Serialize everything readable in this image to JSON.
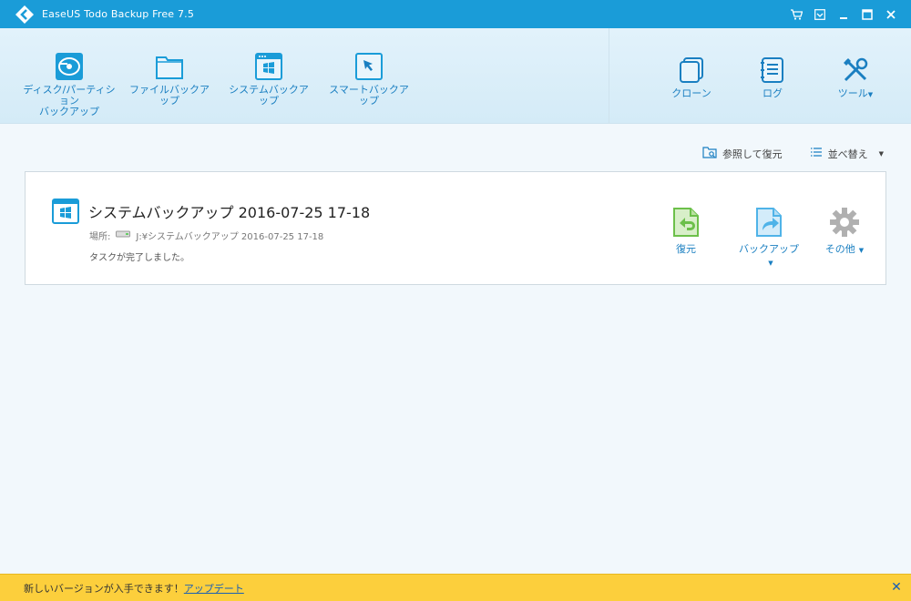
{
  "window": {
    "title": "EaseUS Todo Backup Free 7.5",
    "controls": [
      "cart-icon",
      "menu-icon",
      "minimize-icon",
      "maximize-icon",
      "close-icon"
    ]
  },
  "toolbar": {
    "left": [
      {
        "label_line1": "ディスク/パーティション",
        "label_line2": "バックアップ",
        "icon": "disk-backup-icon"
      },
      {
        "label_line1": "ファイルバックアップ",
        "label_line2": "",
        "icon": "folder-icon"
      },
      {
        "label_line1": "システムバックアップ",
        "label_line2": "",
        "icon": "windows-icon"
      },
      {
        "label_line1": "スマートバックアップ",
        "label_line2": "",
        "icon": "smart-cursor-icon"
      }
    ],
    "right": [
      {
        "label": "クローン",
        "icon": "clone-icon"
      },
      {
        "label": "ログ",
        "icon": "log-icon"
      },
      {
        "label": "ツール",
        "icon": "tools-icon"
      }
    ]
  },
  "content": {
    "browse_restore": "参照して復元",
    "sort": "並べ替え",
    "task": {
      "title": "システムバックアップ 2016-07-25 17-18",
      "location_label": "場所:",
      "location_value": "J:¥システムバックアップ 2016-07-25 17-18",
      "status": "タスクが完了しました。",
      "actions": [
        {
          "label": "復元",
          "icon": "restore-icon",
          "color": "#6cc04a"
        },
        {
          "label": "バックアップ",
          "icon": "backup-share-icon",
          "color": "#4fb3e8"
        },
        {
          "label": "その他",
          "icon": "gear-icon",
          "color": "#a8a8a8"
        }
      ]
    }
  },
  "notification": {
    "text": "新しいバージョンが入手できます！",
    "link": "アップデート"
  },
  "colors": {
    "titlebar": "#1a9cd8",
    "accent": "#1a7fc1",
    "notify": "#fccf3c"
  }
}
